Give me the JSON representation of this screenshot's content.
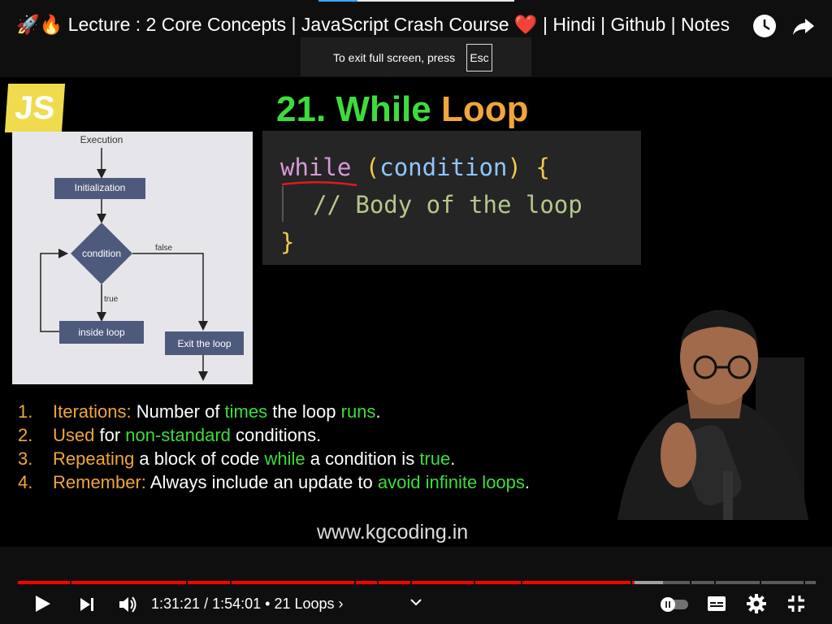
{
  "window": {
    "title": "🚀🔥 Lecture : 2 Core Concepts | JavaScript Crash Course ❤️ | Hindi | Github | Notes"
  },
  "top_icons": {
    "clock": "watch-later-icon",
    "share": "share-icon"
  },
  "fullscreen_toast": {
    "message": "To exit full screen, press",
    "key": "Esc"
  },
  "slide": {
    "logo": "JS",
    "title_number": "21.",
    "title_main": "While",
    "title_accent": "Loop",
    "colors": {
      "green": "#3ddc3d",
      "orange": "#f2a53a",
      "pink": "#d79bd6",
      "blue": "#8fc7ff",
      "yellow": "#f2c94c",
      "comment": "#b5c78a",
      "code_bg": "#252525"
    },
    "code": {
      "keyword": "while",
      "paren_open": "(",
      "condition": "condition",
      "paren_close": ")",
      "brace_open": "{",
      "comment": "// Body of the loop",
      "brace_close": "}"
    },
    "flowchart": {
      "execution": "Execution",
      "init": "Initialization",
      "condition": "condition",
      "false_label": "false",
      "true_label": "true",
      "inside": "inside loop",
      "exit": "Exit the loop"
    },
    "points": [
      {
        "num": "1.",
        "parts": [
          {
            "t": "Iterations:",
            "c": "orange"
          },
          {
            "t": " Number of ",
            "c": "white"
          },
          {
            "t": "times",
            "c": "green"
          },
          {
            "t": " the loop ",
            "c": "white"
          },
          {
            "t": "runs",
            "c": "green"
          },
          {
            "t": ".",
            "c": "white"
          }
        ]
      },
      {
        "num": "2.",
        "parts": [
          {
            "t": "Used",
            "c": "orange"
          },
          {
            "t": " for ",
            "c": "white"
          },
          {
            "t": "non-standard",
            "c": "green"
          },
          {
            "t": " conditions.",
            "c": "white"
          }
        ]
      },
      {
        "num": "3.",
        "parts": [
          {
            "t": "Repeating",
            "c": "orange"
          },
          {
            "t": " a block of code ",
            "c": "white"
          },
          {
            "t": "while",
            "c": "green"
          },
          {
            "t": " a condition is ",
            "c": "white"
          },
          {
            "t": "true",
            "c": "green"
          },
          {
            "t": ".",
            "c": "white"
          }
        ]
      },
      {
        "num": "4.",
        "parts": [
          {
            "t": "Remember:",
            "c": "orange"
          },
          {
            "t": " Always include an update to ",
            "c": "white"
          },
          {
            "t": "avoid infinite loops",
            "c": "green"
          },
          {
            "t": ".",
            "c": "white"
          }
        ]
      }
    ],
    "website": "www.kgcoding.in"
  },
  "player": {
    "current_time": "1:31:21",
    "separator": " / ",
    "duration": "1:54:01",
    "chapter_sep": " • ",
    "chapter": "21 Loops",
    "chapter_arrow": "›",
    "progress": 0.7734,
    "buffered": 0.8085,
    "colors": {
      "played": "#ff0000",
      "buffered": "#a0a0a0",
      "track": "#5a5a5a"
    }
  }
}
